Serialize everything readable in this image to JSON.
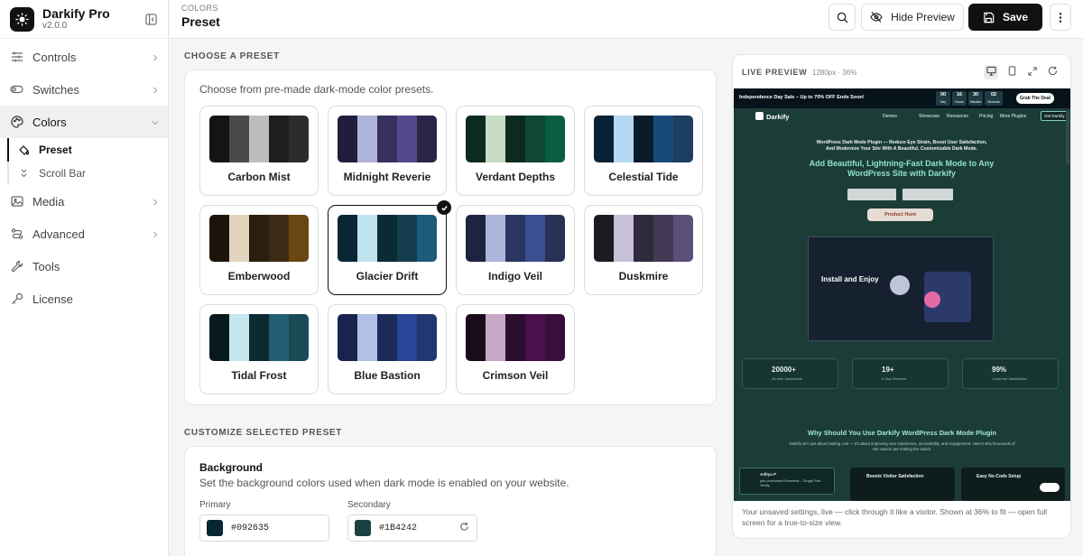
{
  "brand": {
    "name": "Darkify Pro",
    "version": "v2.0.0"
  },
  "nav": {
    "items": [
      {
        "label": "Controls"
      },
      {
        "label": "Switches"
      },
      {
        "label": "Colors"
      },
      {
        "label": "Media"
      },
      {
        "label": "Advanced"
      },
      {
        "label": "Tools"
      },
      {
        "label": "License"
      }
    ],
    "sub_items": [
      {
        "label": "Preset"
      },
      {
        "label": "Scroll Bar"
      }
    ]
  },
  "header": {
    "breadcrumb": "COLORS",
    "title": "Preset",
    "hide_preview_label": "Hide Preview",
    "save_label": "Save"
  },
  "presets_section": {
    "heading": "CHOOSE A PRESET",
    "intro": "Choose from pre-made dark-mode color presets.",
    "selected": "Glacier Drift",
    "presets": [
      {
        "name": "Carbon Mist",
        "colors": [
          "#141414",
          "#4a4a4a",
          "#bdbdbd",
          "#1e1e1e",
          "#2c2c2c"
        ]
      },
      {
        "name": "Midnight Reverie",
        "colors": [
          "#221d3c",
          "#aeb3d8",
          "#35305e",
          "#524a8c",
          "#2a2447"
        ]
      },
      {
        "name": "Verdant Depths",
        "colors": [
          "#0b2b22",
          "#c6dcc4",
          "#0c2b20",
          "#0e4733",
          "#0a5d3f"
        ]
      },
      {
        "name": "Celestial Tide",
        "colors": [
          "#0a2236",
          "#b6d8f2",
          "#0b1b2c",
          "#174a77",
          "#1d3e5f"
        ]
      },
      {
        "name": "Emberwood",
        "colors": [
          "#1d1309",
          "#e4d4bd",
          "#2a1e0f",
          "#3c2a16",
          "#6a4612"
        ]
      },
      {
        "name": "Glacier Drift",
        "colors": [
          "#0a2535",
          "#bfe3ee",
          "#0c2a36",
          "#143d4d",
          "#1d5b7a"
        ]
      },
      {
        "name": "Indigo Veil",
        "colors": [
          "#1e2440",
          "#acb5da",
          "#2a3562",
          "#3c4f91",
          "#283056"
        ]
      },
      {
        "name": "Duskmire",
        "colors": [
          "#1c1a22",
          "#c7c0d7",
          "#2f2a3c",
          "#433a55",
          "#5a4e7a"
        ]
      },
      {
        "name": "Tidal Frost",
        "colors": [
          "#071a1d",
          "#c4e6ee",
          "#0d2a30",
          "#225f72",
          "#194b57"
        ]
      },
      {
        "name": "Blue Bastion",
        "colors": [
          "#18244f",
          "#b0c1e6",
          "#1b2a58",
          "#27469a",
          "#223670"
        ]
      },
      {
        "name": "Crimson Veil",
        "colors": [
          "#1b0a1c",
          "#c6a7c6",
          "#2b0e2d",
          "#4a0f4d",
          "#3a0d3b"
        ]
      }
    ]
  },
  "customize_section": {
    "heading": "CUSTOMIZE SELECTED PRESET",
    "background_title": "Background",
    "background_desc": "Set the background colors used when dark mode is enabled on your website.",
    "primary": {
      "label": "Primary",
      "value": "#092635"
    },
    "secondary": {
      "label": "Secondary",
      "value": "#1B4242"
    }
  },
  "preview": {
    "heading": "LIVE PREVIEW",
    "meta": "1280px · 36%",
    "footer": "Your unsaved settings, live — click through it like a visitor. Shown at 36% to fit — open full screen for a true-to-size view.",
    "site": {
      "promo": "Independence Day Sale – Up to 70% OFF Ends Soon!",
      "countdown": [
        {
          "n": "00",
          "u": "Day"
        },
        {
          "n": "16",
          "u": "Hours"
        },
        {
          "n": "30",
          "u": "Minutes"
        },
        {
          "n": "02",
          "u": "Seconds"
        }
      ],
      "promo_btn": "Grab The Deal",
      "logo": "Darkify",
      "menu": [
        "Demos",
        "Showcase",
        "Resources",
        "Pricing",
        "More Plugins"
      ],
      "get_btn": "Get Darkify",
      "tagline": "WordPress Dark Mode Plugin — Reduce Eye Strain, Boost User Satisfaction, And Modernize Your Site With A Beautiful, Customizable Dark Mode.",
      "headline": "Add Beautiful, Lightning-Fast Dark Mode to Any WordPress Site with Darkify",
      "product_hunt": "Product Hunt",
      "video_title": "Install and Enjoy",
      "stats": [
        {
          "value": "20000+",
          "label": "All-time downloads"
        },
        {
          "value": "19+",
          "label": "5-Star Reviews"
        },
        {
          "value": "99%",
          "label": "Customer Satisfaction"
        }
      ],
      "why_title": "Why Should You Use Darkify WordPress Dark Mode Plugin",
      "why_desc": "Darkify isn't just about looking cool — it's about improving user experience, accessibility, and engagement. Here's why thousands of site owners are making the switch.",
      "toast_user": "Aditya P",
      "toast_text": "just purchased Essential – Single Site - Yearly",
      "features": [
        "Boosts Visitor Satisfaction",
        "Easy No-Code Setup"
      ]
    }
  }
}
